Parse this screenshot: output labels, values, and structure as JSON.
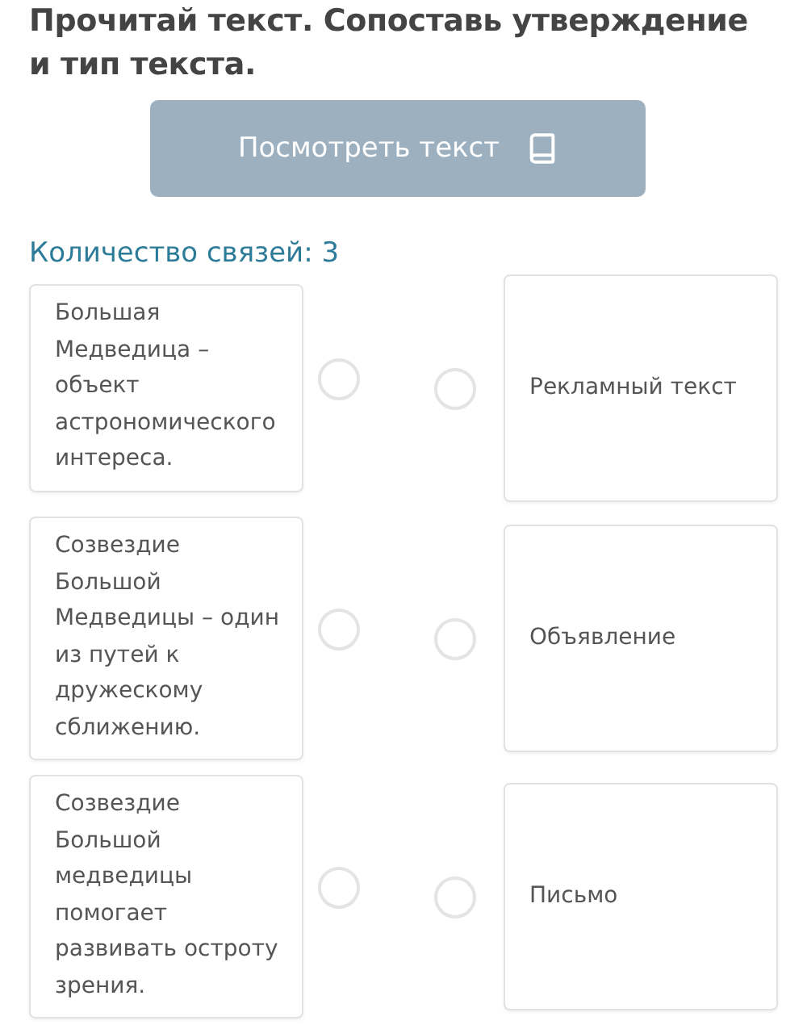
{
  "title": "Прочитай текст. Сопоставь утверждение и тип текста.",
  "view_button": {
    "label": "Посмотреть текст"
  },
  "connections_count": "Количество связей: 3",
  "statements": [
    {
      "text": "Большая Медведица – объект астрономического интереса."
    },
    {
      "text": "Созвездие Большой Медведицы – один из путей к дружескому сближению."
    },
    {
      "text": "Созвездие Большой медведицы помогает развивать остроту зрения."
    }
  ],
  "text_types": [
    {
      "text": "Рекламный текст"
    },
    {
      "text": "Объявление"
    },
    {
      "text": "Письмо"
    }
  ]
}
